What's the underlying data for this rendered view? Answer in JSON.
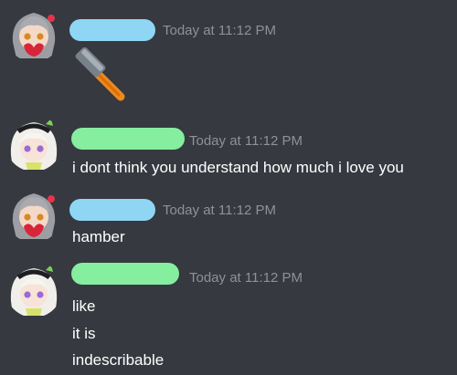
{
  "colors": {
    "background": "#36393f",
    "timestamp": "#8e9297",
    "text": "#ffffff",
    "user_a_name_blob": "#8fd6f5",
    "user_b_name_blob": "#85ee9f"
  },
  "messages": [
    {
      "author": "user-a",
      "avatar": "gray-hair-anime-avatar",
      "timestamp": "Today at 11:12 PM",
      "lines": [],
      "attachment_icon": "hammer-emoji"
    },
    {
      "author": "user-b",
      "avatar": "white-hair-anime-avatar",
      "timestamp": "Today at 11:12 PM",
      "lines": [
        "i dont think you understand how much i love you"
      ]
    },
    {
      "author": "user-a",
      "avatar": "gray-hair-anime-avatar",
      "timestamp": "Today at 11:12 PM",
      "lines": [
        "hamber"
      ]
    },
    {
      "author": "user-b",
      "avatar": "white-hair-anime-avatar",
      "timestamp": "Today at 11:12 PM",
      "lines": [
        "like",
        "it is",
        "indescribable"
      ]
    }
  ]
}
